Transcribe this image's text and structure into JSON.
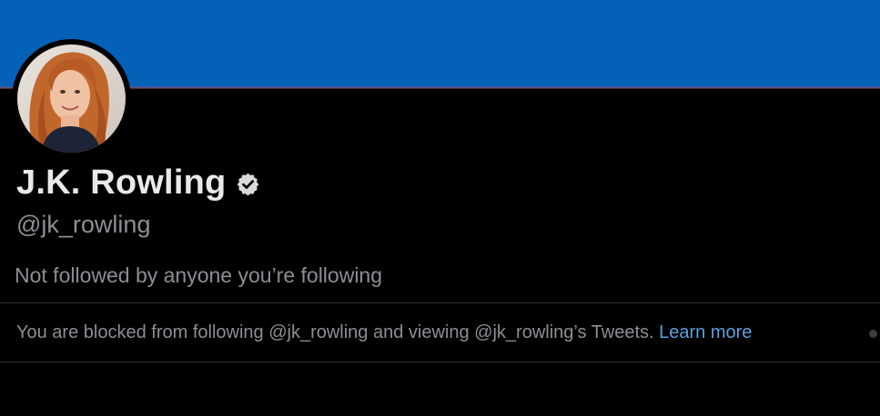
{
  "profile": {
    "display_name": "J.K. Rowling",
    "verified_icon": "verified-badge-icon",
    "handle": "@jk_rowling",
    "followed_by_text": "Not followed by anyone you’re following"
  },
  "blocked": {
    "message": "You are blocked from following @jk_rowling and viewing @jk_rowling’s Tweets.",
    "link_label": "Learn more"
  },
  "colors": {
    "banner": "#0461b8",
    "background": "#000000",
    "primary_text": "#e7e9ea",
    "secondary_text": "#8b8f94",
    "link": "#5b9fe0",
    "divider": "#2f3336"
  }
}
